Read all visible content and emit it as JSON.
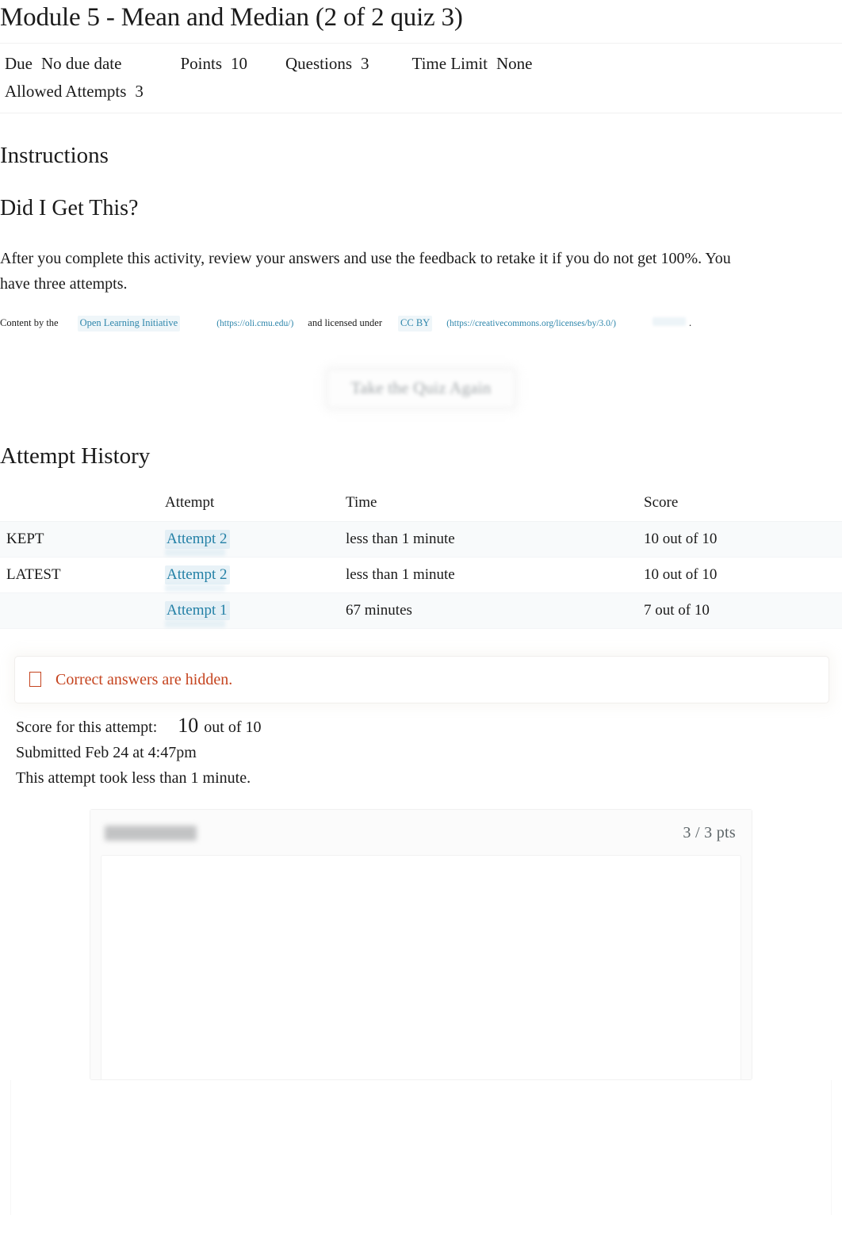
{
  "quiz": {
    "title": "Module 5 - Mean and Median (2 of 2 quiz 3)",
    "meta": {
      "due_label": "Due",
      "due_value": "No due date",
      "points_label": "Points",
      "points_value": "10",
      "questions_label": "Questions",
      "questions_value": "3",
      "time_limit_label": "Time Limit",
      "time_limit_value": "None",
      "allowed_attempts_label": "Allowed Attempts",
      "allowed_attempts_value": "3"
    }
  },
  "instructions": {
    "heading": "Instructions",
    "subheading": "Did I Get This?",
    "paragraph": "After you complete this activity, review your answers and use the feedback to retake it if you do not get 100%. You have three attempts.",
    "attribution": {
      "prefix": "Content by the",
      "link1_text": "Open Learning Initiative",
      "link1_url": "(https://oli.cmu.edu/)",
      "middle": "and licensed under",
      "link2_text": "CC BY",
      "link2_url": "(https://creativecommons.org/licenses/by/3.0/)",
      "suffix": "."
    }
  },
  "actions": {
    "take_quiz_again": "Take the Quiz Again"
  },
  "attempt_history": {
    "heading": "Attempt History",
    "columns": [
      "",
      "Attempt",
      "Time",
      "Score"
    ],
    "rows": [
      {
        "flag": "KEPT",
        "attempt": "Attempt 2",
        "time": "less than 1 minute",
        "score": "10 out of 10"
      },
      {
        "flag": "LATEST",
        "attempt": "Attempt 2",
        "time": "less than 1 minute",
        "score": "10 out of 10"
      },
      {
        "flag": "",
        "attempt": "Attempt 1",
        "time": "67 minutes",
        "score": "7 out of 10"
      }
    ]
  },
  "alert": {
    "icon": "warning-icon",
    "message": "Correct answers are hidden.",
    "color": "#c5441f"
  },
  "attempt_summary": {
    "score_label": "Score for this attempt:",
    "score_value": "10",
    "score_suffix": "out of 10",
    "submitted": "Submitted Feb 24 at 4:47pm",
    "duration": "This attempt took less than 1 minute."
  },
  "question_card": {
    "label_redacted": true,
    "points": "3 / 3 pts"
  },
  "colors": {
    "link": "#2380a6",
    "alert": "#c5441f",
    "text": "#1a1a1a",
    "muted": "#5c6467"
  }
}
